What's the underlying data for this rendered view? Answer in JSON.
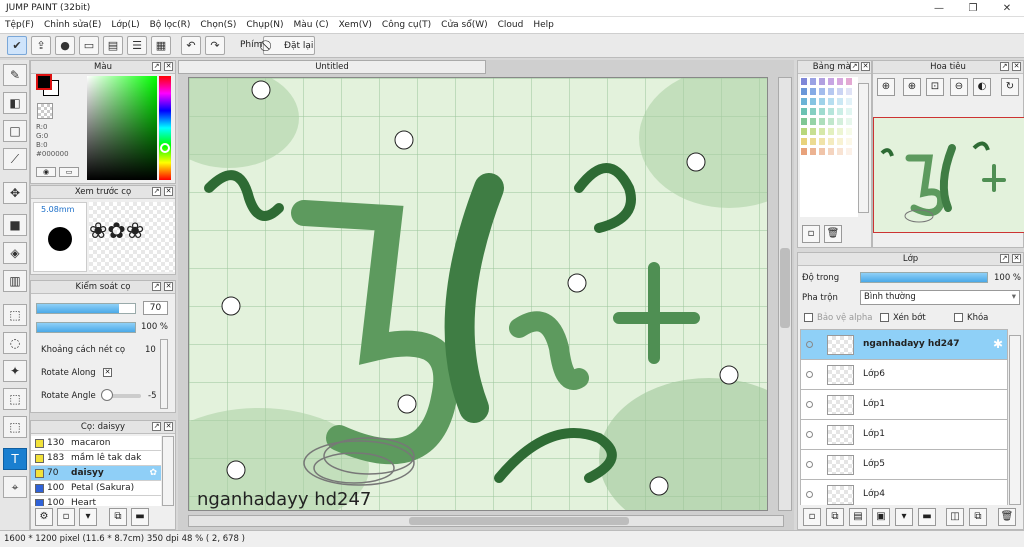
{
  "app": {
    "title": "JUMP PAINT (32bit)"
  },
  "window_controls": [
    "—",
    "❐",
    "✕"
  ],
  "menu": [
    "Tệp(F)",
    "Chỉnh sửa(E)",
    "Lớp(L)",
    "Bộ lọc(R)",
    "Chọn(S)",
    "Chụp(N)",
    "Màu (C)",
    "Xem(V)",
    "Công cụ(T)",
    "Cửa sổ(W)",
    "Cloud",
    "Help"
  ],
  "toolbar": {
    "pen_label": "Phím",
    "reset_label": "Đặt lại"
  },
  "canvas": {
    "tab_title": "Untitled",
    "artwork_text": "nganhadayy hd247",
    "artwork_big": "5lr+"
  },
  "color_panel": {
    "title": "Màu",
    "r": "R:0",
    "g": "G:0",
    "b": "B:0",
    "hex": "#000000",
    "primary_color": "#000000",
    "secondary_color": "#ffffff"
  },
  "brush_preview": {
    "title": "Xem trước cọ",
    "size": "5.08mm"
  },
  "brush_control": {
    "title": "Kiểm soát cọ",
    "size_value": "70",
    "opacity_value": "100 %",
    "spacing_label": "Khoảng cách nét cọ",
    "spacing_value": "10",
    "rotate_along_label": "Rotate Along",
    "rotate_angle_label": "Rotate Angle",
    "rotate_angle_value": "-5"
  },
  "brush_list": {
    "title": "Cọ: daisyy",
    "items": [
      {
        "size": "130",
        "name": "macaron",
        "color": "#f2e23a"
      },
      {
        "size": "183",
        "name": "mầm lê tak dak",
        "color": "#f2e23a"
      },
      {
        "size": "70",
        "name": "daisyy",
        "color": "#f2e23a"
      },
      {
        "size": "100",
        "name": "Petal (Sakura)",
        "color": "#2f62d8"
      },
      {
        "size": "100",
        "name": "Heart",
        "color": "#2f62d8"
      }
    ]
  },
  "palette": {
    "title": "Bảng màu",
    "swatches": [
      "#7f87d8",
      "#9aa2e4",
      "#b1a0e0",
      "#c7a5e3",
      "#d7a7df",
      "#e3a9d3",
      "#6a97d8",
      "#86abe5",
      "#a3bcec",
      "#b6c8f0",
      "#cbd4f3",
      "#e0e3f6",
      "#6cb3d6",
      "#86c4e2",
      "#9fd2e9",
      "#b6def0",
      "#cbe8f4",
      "#e2f2f8",
      "#6cc2b3",
      "#86cfc2",
      "#9fdbcf",
      "#b6e5db",
      "#cbeee6",
      "#e1f6f1",
      "#7fc794",
      "#96d3a7",
      "#addebb",
      "#c1e7cc",
      "#d4efdc",
      "#e7f7ec",
      "#b8d77b",
      "#c7df92",
      "#d6e8a9",
      "#e3f0bf",
      "#edf5d3",
      "#f6fbe8",
      "#e8d27b",
      "#ecdb92",
      "#f0e3a9",
      "#f4ebbf",
      "#f8f2d3",
      "#fcf8e8",
      "#e8a27b",
      "#ecb392",
      "#f0c4a9",
      "#f4d4bf",
      "#f8e3d3",
      "#fcf1e8"
    ]
  },
  "navigator": {
    "title": "Hoa tiêu"
  },
  "layers": {
    "title": "Lớp",
    "opacity_label": "Độ trong",
    "opacity_value": "100 %",
    "blend_label": "Pha trộn",
    "blend_value": "Bình thường",
    "protect_alpha": "Bảo vệ alpha",
    "clip": "Xén bớt",
    "lock": "Khóa",
    "items": [
      {
        "name": "nganhadayy hd247",
        "selected": true
      },
      {
        "name": "Lớp6",
        "selected": false
      },
      {
        "name": "Lớp1",
        "selected": false
      },
      {
        "name": "Lớp1",
        "selected": false
      },
      {
        "name": "Lớp5",
        "selected": false
      },
      {
        "name": "Lớp4",
        "selected": false
      }
    ]
  },
  "status": {
    "text": "1600 * 1200 pixel   (11.6 * 8.7cm)   350 dpi   48 %   ( 2, 678 )"
  }
}
